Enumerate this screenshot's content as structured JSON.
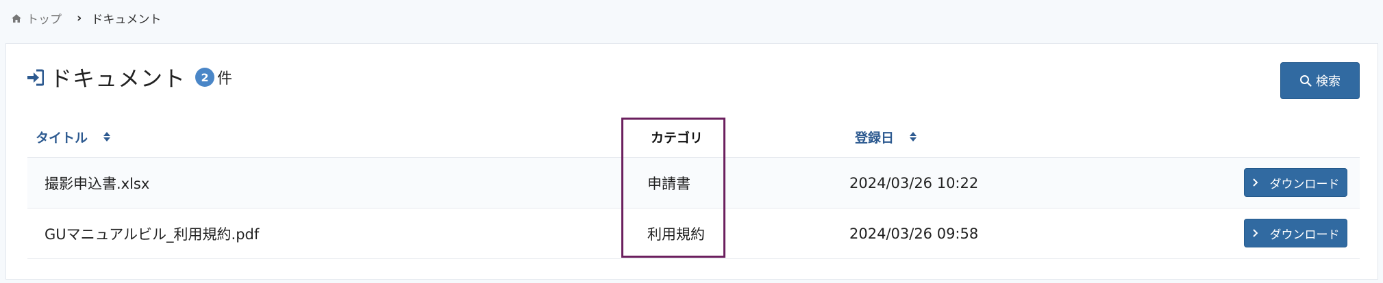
{
  "breadcrumb": {
    "home_label": "トップ",
    "current_label": "ドキュメント",
    "home_icon": "home-icon"
  },
  "header": {
    "title": "ドキュメント",
    "count": "2",
    "count_unit": "件",
    "icon": "sign-in-icon"
  },
  "search_button": {
    "label": "検索",
    "icon": "search-icon"
  },
  "table": {
    "columns": [
      {
        "label": "タイトル",
        "sortable": true
      },
      {
        "label": "カテゴリ",
        "sortable": false
      },
      {
        "label": "登録日",
        "sortable": true
      }
    ],
    "rows": [
      {
        "title": "撮影申込書.xlsx",
        "category": "申請書",
        "date": "2024/03/26 10:22",
        "action": "ダウンロード"
      },
      {
        "title": "GUマニュアルビル_利用規約.pdf",
        "category": "利用規約",
        "date": "2024/03/26 09:58",
        "action": "ダウンロード"
      }
    ]
  },
  "colors": {
    "accent": "#316aa1",
    "header_link": "#2d5a90",
    "badge": "#4a86c7",
    "highlight": "#6b1f5e"
  }
}
